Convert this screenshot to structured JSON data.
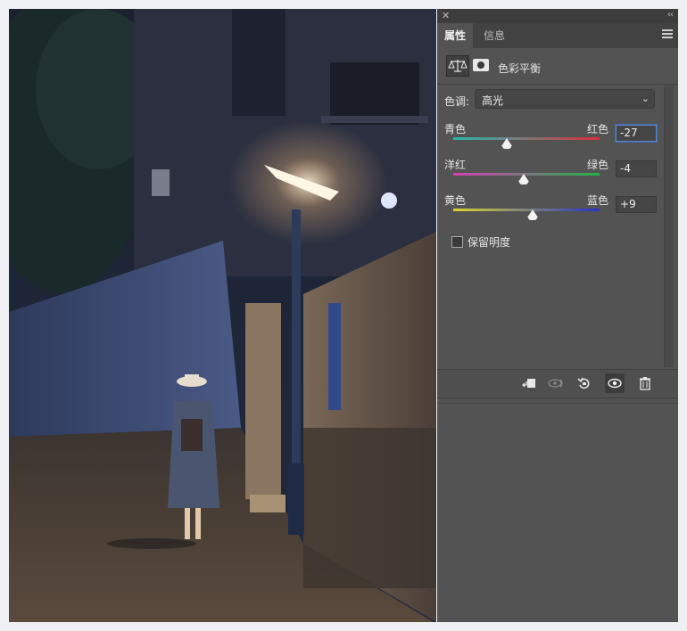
{
  "panel": {
    "close_glyph": "✕",
    "collapse_glyph": "‹‹",
    "tabs": [
      {
        "label": "属性",
        "active": true
      },
      {
        "label": "信息",
        "active": false
      }
    ],
    "menu_icon": "panel-menu-icon",
    "adjustment_title": "色彩平衡",
    "tone": {
      "label": "色调:",
      "selected": "高光"
    },
    "sliders": [
      {
        "left": "青色",
        "right": "红色",
        "value": "-27",
        "numeric": -27,
        "gradient": [
          "#2ab7b0",
          "#d8313a"
        ],
        "focused": true
      },
      {
        "left": "洋红",
        "right": "绿色",
        "value": "-4",
        "numeric": -4,
        "gradient": [
          "#d63fb2",
          "#22b24a"
        ],
        "focused": false
      },
      {
        "left": "黄色",
        "right": "蓝色",
        "value": "+9",
        "numeric": 9,
        "gradient": [
          "#d9d431",
          "#2432c9"
        ],
        "focused": false
      }
    ],
    "preserve_luminosity": {
      "label": "保留明度",
      "checked": false
    },
    "bottom_icons": [
      "clip-to-layer-icon",
      "view-previous-icon",
      "reset-icon",
      "visibility-eye-icon",
      "trash-icon"
    ]
  },
  "canvas": {
    "description_icon": "photo-canvas"
  }
}
